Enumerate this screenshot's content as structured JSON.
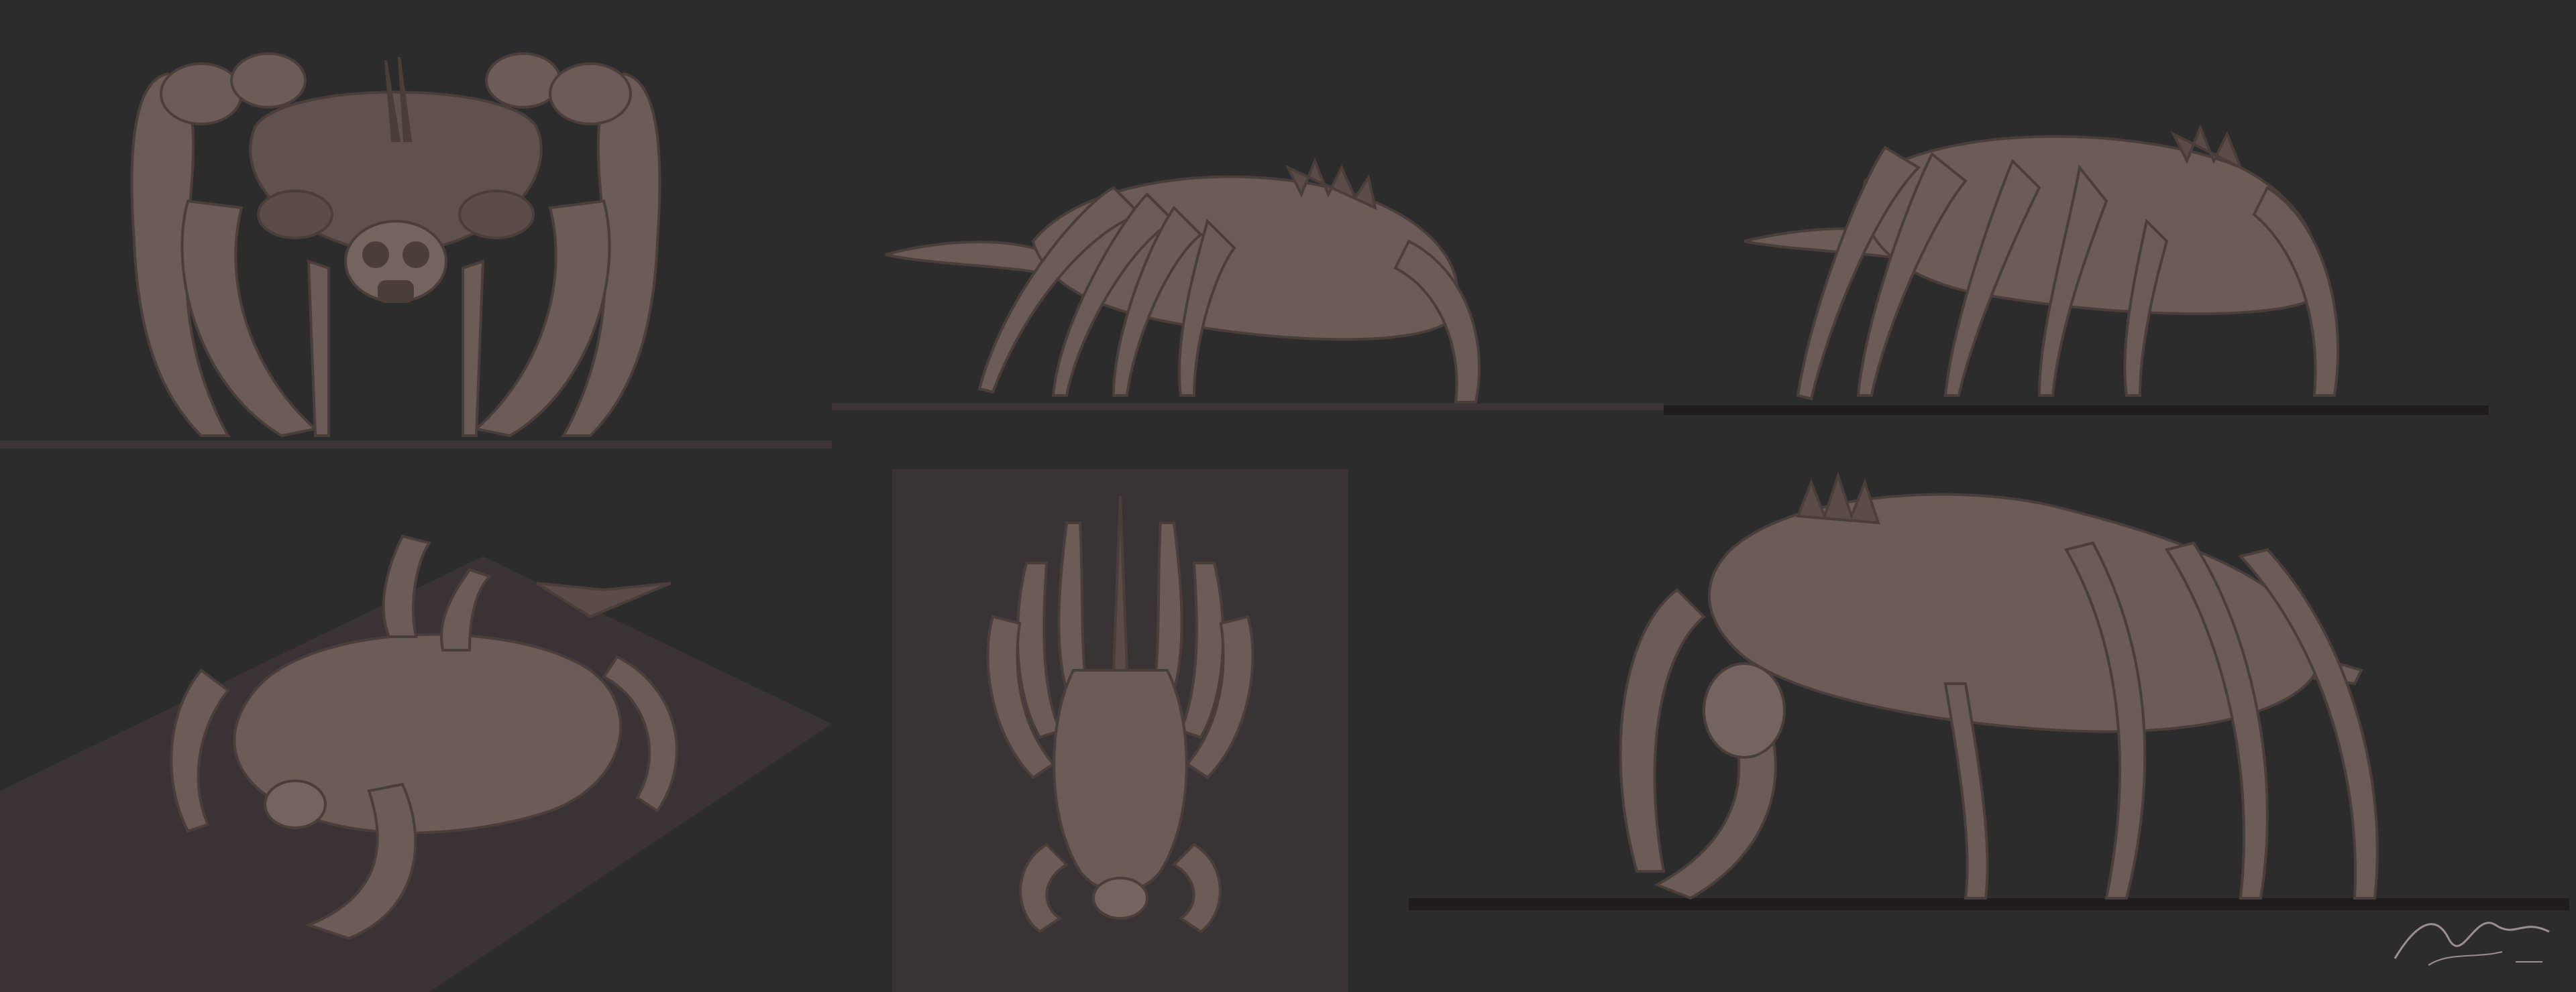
{
  "sheet": {
    "background": "#2c2c2d",
    "model_color": "#6b5c58",
    "model_shadow": "#4a3e3b",
    "model_highlight": "#8a7a75",
    "ground_color": "#3c3436",
    "isometric_ground_color": "#3a3234",
    "top_view_panel_color": "#3a3335"
  },
  "views": [
    {
      "id": "front"
    },
    {
      "id": "side-left"
    },
    {
      "id": "side-three-quarter"
    },
    {
      "id": "isometric"
    },
    {
      "id": "top"
    },
    {
      "id": "perspective"
    }
  ],
  "signature": {
    "icon": "artist-signature-icon"
  }
}
